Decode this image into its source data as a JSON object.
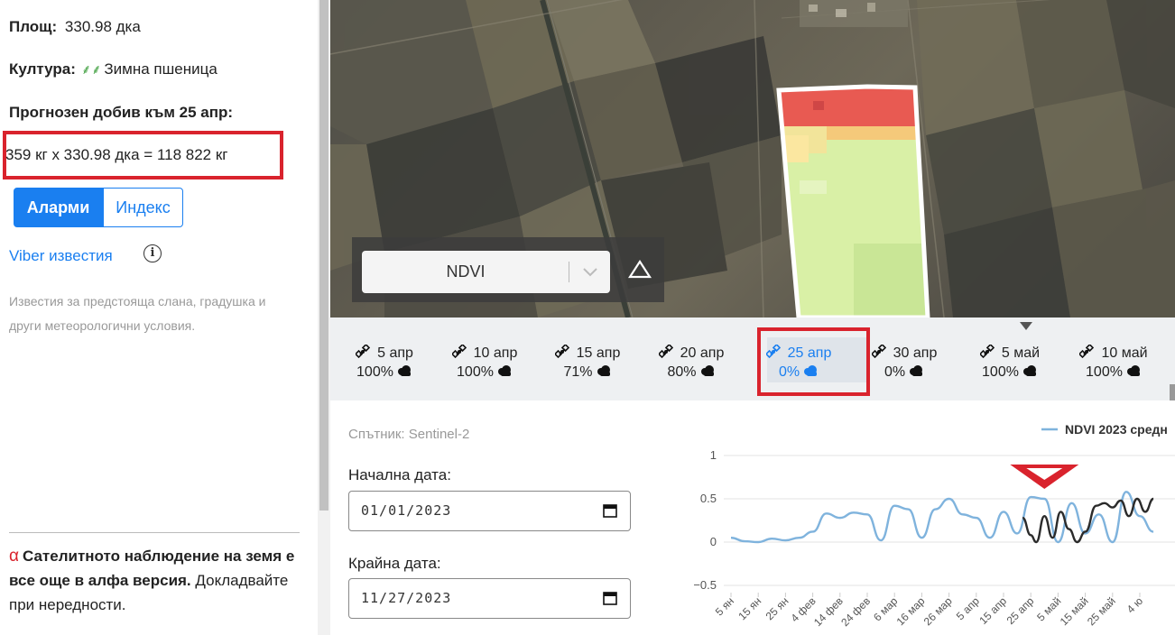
{
  "field": {
    "area_label": "Площ:",
    "area_value": "330.98 дка",
    "crop_label": "Култура:",
    "crop_value": "Зимна пшеница",
    "forecast_label": "Прогнозен добив към 25 апр:",
    "forecast_formula": "359 кг х 330.98 дка = 118 822 кг"
  },
  "toggle": {
    "alarms": "Аларми",
    "index": "Индекс"
  },
  "viber": {
    "link": "Viber известия",
    "info_glyph": "i",
    "description": "Известия за предстояща слана, градушка и други метеорологични условия."
  },
  "notice": {
    "alpha_glyph": "α",
    "bold": "Сателитното наблюдение на земя е все още в алфа версия.",
    "text": "Докладвайте при нередности."
  },
  "map": {
    "layer_value": "NDVI"
  },
  "timeline": {
    "items": [
      {
        "date": "5 апр",
        "cloud": "100%"
      },
      {
        "date": "10 апр",
        "cloud": "100%"
      },
      {
        "date": "15 апр",
        "cloud": "71%"
      },
      {
        "date": "20 апр",
        "cloud": "80%"
      },
      {
        "date": "25 апр",
        "cloud": "0%"
      },
      {
        "date": "30 апр",
        "cloud": "0%"
      },
      {
        "date": "5 май",
        "cloud": "100%"
      },
      {
        "date": "10 май",
        "cloud": "100%"
      }
    ],
    "selected_index": 4
  },
  "filters": {
    "satellite": "Спътник: Sentinel-2",
    "start_label": "Начална дата:",
    "start_value": "01/01/2023",
    "end_label": "Крайна дата:",
    "end_value": "11/27/2023"
  },
  "colors": {
    "accent": "#1a7ff0",
    "highlight": "#d9232d",
    "series_2023": "#7fb3dd",
    "series_other": "#2b2b2b"
  },
  "chart_data": {
    "type": "line",
    "legend": "NDVI 2023 средн",
    "ylim": [
      -0.5,
      1
    ],
    "yticks": [
      "1",
      "0.5",
      "0",
      "−0.5"
    ],
    "xticks": [
      "5 ян",
      "15 ян",
      "25 ян",
      "4 фев",
      "14 фев",
      "24 фев",
      "6 мар",
      "16 мар",
      "26 мар",
      "5 апр",
      "15 апр",
      "25 апр",
      "5 май",
      "15 май",
      "25 май",
      "4 ю"
    ],
    "series": [
      {
        "name": "NDVI 2023 средн",
        "x": [
          0,
          0.5,
          1,
          1.5,
          2,
          2.5,
          3,
          3.5,
          4,
          4.5,
          5,
          5.5,
          6,
          6.5,
          7,
          7.5,
          8,
          8.5,
          9,
          9.5,
          10,
          10.5,
          11,
          11.5,
          12,
          12.5,
          13,
          13.5,
          14,
          14.5,
          15,
          15.5
        ],
        "values": [
          0.05,
          0.01,
          0.0,
          0.04,
          0.02,
          0.05,
          0.12,
          0.33,
          0.28,
          0.34,
          0.32,
          0.02,
          0.42,
          0.38,
          0.05,
          0.38,
          0.5,
          0.32,
          0.28,
          0.05,
          0.35,
          0.1,
          0.52,
          0.5,
          0.0,
          0.45,
          0.1,
          0.32,
          0.0,
          0.58,
          0.3,
          0.12
        ]
      },
      {
        "x": [
          10.7,
          11,
          11.2,
          11.5,
          11.8,
          12.1,
          12.4,
          12.7,
          13,
          13.4,
          13.7,
          14,
          14.3,
          14.6,
          14.9,
          15.2,
          15.5
        ],
        "values": [
          0.28,
          0.08,
          0.0,
          0.3,
          0.05,
          0.35,
          0.15,
          0.0,
          0.12,
          0.42,
          0.45,
          0.4,
          0.48,
          0.3,
          0.5,
          0.35,
          0.5
        ]
      }
    ]
  }
}
